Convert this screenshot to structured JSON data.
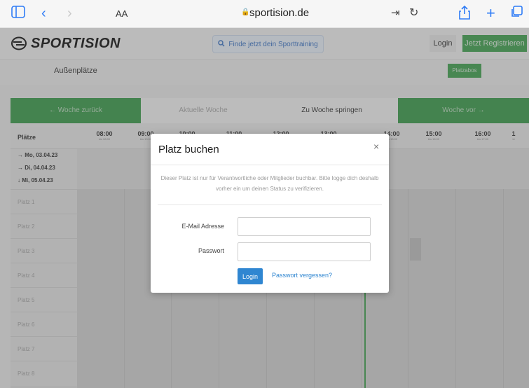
{
  "browser": {
    "text_size": "AA",
    "url": "sportision.de"
  },
  "header": {
    "logo": "SPORTISION",
    "search": "Finde jetzt dein Sporttraining",
    "login": "Login",
    "register": "Jetzt Registrieren"
  },
  "subnav": {
    "title": "Außenplätze",
    "platzabos": "Platzabos"
  },
  "week_nav": {
    "back": "←  Woche zurück",
    "current": "Aktuelle Woche",
    "jump": "Zu Woche springen",
    "next": "Woche vor  →"
  },
  "grid": {
    "courts_header": "Plätze",
    "times": [
      {
        "time": "08:00",
        "sub": "bis 08:00"
      },
      {
        "time": "09:00",
        "sub": "bis 10:00"
      },
      {
        "time": "10:00",
        "sub": ""
      },
      {
        "time": "11:00",
        "sub": ""
      },
      {
        "time": "12:00",
        "sub": ""
      },
      {
        "time": "13:00",
        "sub": ""
      },
      {
        "time": "14:00",
        "sub": "bis 15:00"
      },
      {
        "time": "15:00",
        "sub": "bis 16:00"
      },
      {
        "time": "16:00",
        "sub": "bis 17:00"
      },
      {
        "time": "1",
        "sub": "bi"
      }
    ],
    "dates": [
      {
        "icon": "→",
        "label": "Mo, 03.04.23"
      },
      {
        "icon": "→",
        "label": "Di, 04.04.23"
      },
      {
        "icon": "↓",
        "label": "Mi, 05.04.23"
      }
    ],
    "courts": [
      "Platz 1",
      "Platz 2",
      "Platz 3",
      "Platz 4",
      "Platz 5",
      "Platz 6",
      "Platz 7",
      "Platz 8"
    ]
  },
  "modal": {
    "title": "Platz buchen",
    "close": "×",
    "message": "Dieser Platz ist nur für Verantwortliche oder Mitglieder buchbar. Bitte logge dich deshalb vorher ein um deinen Status zu verifizieren.",
    "email_label": "E-Mail Adresse",
    "email_value": "",
    "password_label": "Passwort",
    "password_value": "",
    "login_button": "Login",
    "forgot_link": "Passwort vergessen?"
  }
}
